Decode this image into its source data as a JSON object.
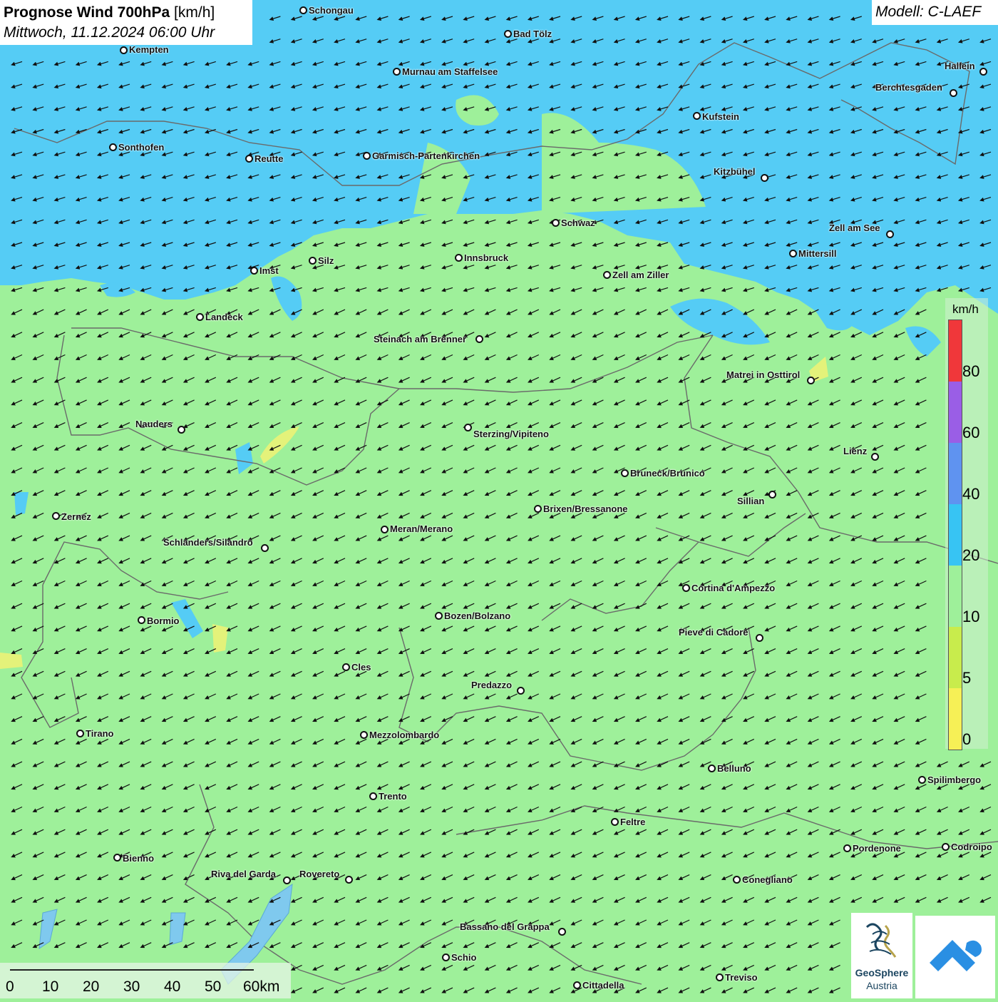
{
  "header": {
    "title_bold": "Prognose Wind 700hPa",
    "title_unit": "[km/h]",
    "datetime": "Mittwoch, 11.12.2024 06:00 Uhr"
  },
  "model": "Modell: C-LAEF",
  "legend": {
    "unit": "km/h",
    "labels": [
      "80",
      "60",
      "40",
      "20",
      "10",
      "5",
      "0"
    ],
    "colors": [
      "#f0373a",
      "#9a5ee6",
      "#5f93f0",
      "#37c4f3",
      "#9ef09a",
      "#c8ec4c",
      "#f6f056"
    ]
  },
  "colors": {
    "calm_fill": "#9ef09a",
    "wind_fill": "#55ccf5",
    "weak_fill": "#e4f27a",
    "border": "#6a6a6a",
    "arrow": "#111111"
  },
  "wind": {
    "direction_to": "west-southwest",
    "arrow_icon": "wind-arrow-icon"
  },
  "scale_bar": {
    "labels": [
      "0",
      "10",
      "20",
      "30",
      "40",
      "50",
      "60km"
    ]
  },
  "logos": {
    "geosphere_line1": "GeoSphere",
    "geosphere_line2": "Austria",
    "geosphere_icon": "geosphere-logo-icon",
    "app_icon": "app-logo-icon"
  },
  "cities": [
    {
      "name": "Schongau"
    },
    {
      "name": "Bad Tölz"
    },
    {
      "name": "Kempten"
    },
    {
      "name": "Murnau am Staffelsee"
    },
    {
      "name": "Hallein"
    },
    {
      "name": "Berchtesgaden"
    },
    {
      "name": "Kufstein"
    },
    {
      "name": "Sonthofen"
    },
    {
      "name": "Reutte"
    },
    {
      "name": "Garmisch-Partenkirchen"
    },
    {
      "name": "Kitzbühel"
    },
    {
      "name": "Schwaz"
    },
    {
      "name": "Zell am See"
    },
    {
      "name": "Mittersill"
    },
    {
      "name": "Innsbruck"
    },
    {
      "name": "Silz"
    },
    {
      "name": "Imst"
    },
    {
      "name": "Zell am Ziller"
    },
    {
      "name": "Landeck"
    },
    {
      "name": "Steinach am Brenner"
    },
    {
      "name": "Matrei in Osttirol"
    },
    {
      "name": "Nauders"
    },
    {
      "name": "Sterzing/Vipiteno"
    },
    {
      "name": "Lienz"
    },
    {
      "name": "Bruneck/Brunico"
    },
    {
      "name": "Sillian"
    },
    {
      "name": "Brixen/Bressanone"
    },
    {
      "name": "Zernez"
    },
    {
      "name": "Meran/Merano"
    },
    {
      "name": "Schlanders/Silandro"
    },
    {
      "name": "Cortina d'Ampezzo"
    },
    {
      "name": "Bozen/Bolzano"
    },
    {
      "name": "Bormio"
    },
    {
      "name": "Pieve di Cadore"
    },
    {
      "name": "Cles"
    },
    {
      "name": "Predazzo"
    },
    {
      "name": "Tirano"
    },
    {
      "name": "Mezzolombardo"
    },
    {
      "name": "Belluno"
    },
    {
      "name": "Spilimbergo"
    },
    {
      "name": "Trento"
    },
    {
      "name": "Feltre"
    },
    {
      "name": "Pordenone"
    },
    {
      "name": "Codroipo"
    },
    {
      "name": "Bienno"
    },
    {
      "name": "Riva del Garda"
    },
    {
      "name": "Rovereto"
    },
    {
      "name": "Conegliano"
    },
    {
      "name": "Bassano del Grappa"
    },
    {
      "name": "Schio"
    },
    {
      "name": "Treviso"
    },
    {
      "name": "Cittadella"
    }
  ]
}
